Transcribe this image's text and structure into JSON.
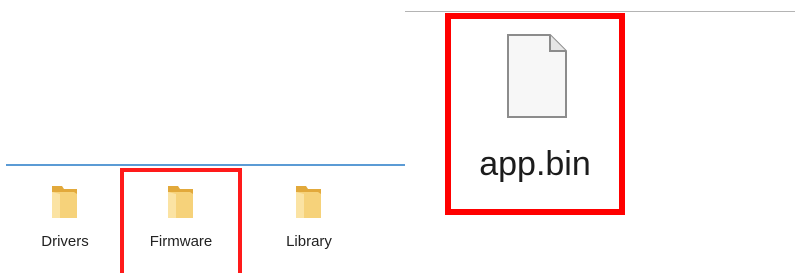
{
  "left_panel": {
    "items": [
      {
        "label": "Drivers",
        "icon": "folder-icon",
        "highlighted": false
      },
      {
        "label": "Firmware",
        "icon": "folder-icon",
        "highlighted": true
      },
      {
        "label": "Library",
        "icon": "folder-icon",
        "highlighted": false
      }
    ]
  },
  "right_panel": {
    "file": {
      "label": "app.bin",
      "icon": "file-icon",
      "highlighted": true
    }
  },
  "colors": {
    "highlight": "#ff0000",
    "folder": "#f4c95d",
    "divider": "#5b9bd5"
  }
}
